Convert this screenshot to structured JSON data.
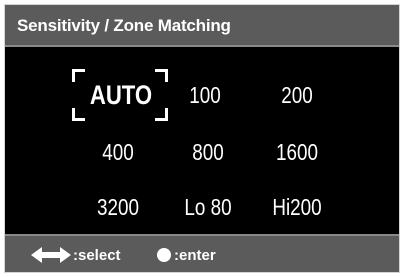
{
  "title": "Sensitivity / Zone Matching",
  "options": {
    "auto": "AUTO",
    "iso100": "100",
    "iso200": "200",
    "iso400": "400",
    "iso800": "800",
    "iso1600": "1600",
    "iso3200": "3200",
    "lo80": "Lo 80",
    "hi200": "Hi200"
  },
  "selected": "AUTO",
  "hints": {
    "select_icon": "left-right-arrows-icon",
    "select_label": ":select",
    "enter_icon": "dot-button-icon",
    "enter_label": ":enter"
  },
  "colors": {
    "background": "#000000",
    "bar": "#5b5b5b",
    "text": "#ffffff"
  }
}
